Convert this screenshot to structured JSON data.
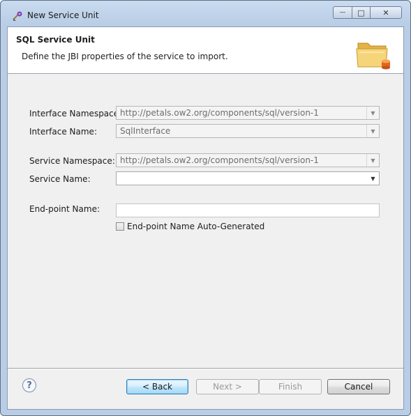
{
  "window": {
    "title": "New Service Unit",
    "buttons": {
      "minimize": "—",
      "maximize": "□",
      "close": "✕"
    }
  },
  "banner": {
    "title": "SQL Service Unit",
    "description": "Define the JBI properties of the service to import."
  },
  "form": {
    "interface_namespace": {
      "label": "Interface Namespace:",
      "value": "http://petals.ow2.org/components/sql/version-1"
    },
    "interface_name": {
      "label": "Interface Name:",
      "value": "SqlInterface"
    },
    "service_namespace": {
      "label": "Service Namespace:",
      "value": "http://petals.ow2.org/components/sql/version-1"
    },
    "service_name": {
      "label": "Service Name:",
      "value": ""
    },
    "endpoint_name": {
      "label": "End-point Name:",
      "value": ""
    },
    "auto_generated": {
      "label": "End-point Name Auto-Generated",
      "checked": false
    }
  },
  "icons": {
    "dropdown_arrow": "▼",
    "help": "?"
  },
  "buttons": {
    "back": "< Back",
    "next": "Next >",
    "finish": "Finish",
    "cancel": "Cancel"
  }
}
